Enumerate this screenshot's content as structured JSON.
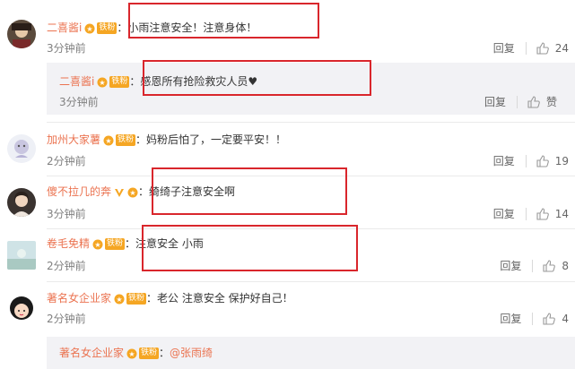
{
  "labels": {
    "reply": "回复",
    "fan_badge": "铁粉",
    "colon": "："
  },
  "comments": [
    {
      "user": "二喜酱i",
      "text": "小雨注意安全！注意身体！",
      "time": "3分钟前",
      "likes": "24"
    },
    {
      "user": "二喜酱i",
      "text": "感恩所有抢险救灾人员♥",
      "time": "3分钟前",
      "likes": "赞"
    },
    {
      "user": "加州大家薯",
      "text": "妈粉后怕了，一定要平安！！",
      "time": "2分钟前",
      "likes": "19"
    },
    {
      "user": "傻不拉几的奔",
      "text": "绮绮子注意安全啊",
      "time": "3分钟前",
      "likes": "14"
    },
    {
      "user": "卷毛免精",
      "text": "注意安全 小雨",
      "time": "2分钟前",
      "likes": "8"
    },
    {
      "user": "著名女企业家",
      "text": "老公 注意安全 保护好自己！",
      "time": "2分钟前",
      "likes": "4"
    },
    {
      "user": "著名女企业家",
      "text": "@张雨绮"
    }
  ],
  "colors": {
    "username": "#eb7350",
    "badge": "#f5a623",
    "highlight_box": "#d9262c",
    "reply_bg": "#f2f2f5"
  }
}
